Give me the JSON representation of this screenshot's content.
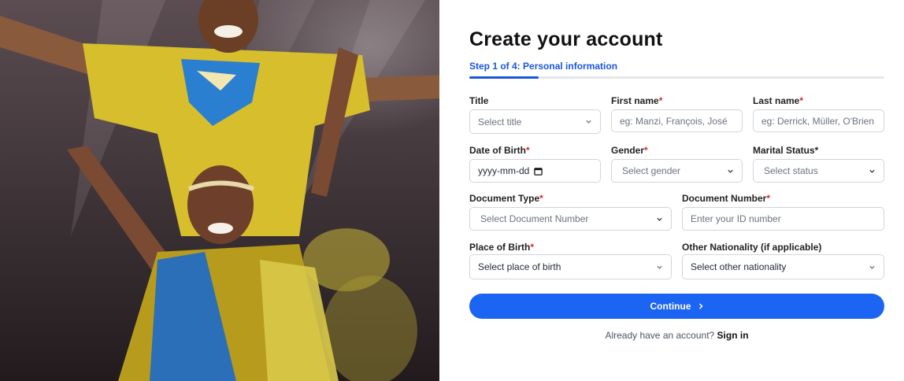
{
  "hero": {
    "image": "two smiling dancers in yellow and blue traditional costumes on stage"
  },
  "form": {
    "title": "Create your account",
    "step_label": "Step 1 of 4: Personal information",
    "progress_fraction": 0.167,
    "fields": {
      "title": {
        "label": "Title",
        "required": "",
        "placeholder": "Select title"
      },
      "first_name": {
        "label": "First name",
        "required": "*",
        "placeholder": "eg: Manzi, François, José"
      },
      "last_name": {
        "label": "Last name",
        "required": "*",
        "placeholder": "eg: Derrick, Müller, O'Brien"
      },
      "dob": {
        "label": "Date of Birth",
        "required": "*",
        "placeholder": "yyyy-mm-dd"
      },
      "gender": {
        "label": "Gender",
        "required": "*",
        "placeholder": "Select gender"
      },
      "marital": {
        "label": "Marital Status*",
        "placeholder": "Select status"
      },
      "doc_type": {
        "label": "Document Type",
        "required": "*",
        "placeholder": "Select Document Number"
      },
      "doc_number": {
        "label": "Document Number",
        "required": "*",
        "placeholder": "Enter your ID number"
      },
      "pob": {
        "label": "Place of Birth",
        "required": "*",
        "placeholder": "Select place of birth"
      },
      "other_nat": {
        "label": "Other Nationality (if applicable)",
        "placeholder": "Select other nationality"
      }
    },
    "continue_label": "Continue",
    "signin_prompt": "Already have an account?",
    "signin_link": "Sign in"
  },
  "colors": {
    "accent": "#1c64f2",
    "required": "#e02424",
    "border": "#d1d5db"
  }
}
